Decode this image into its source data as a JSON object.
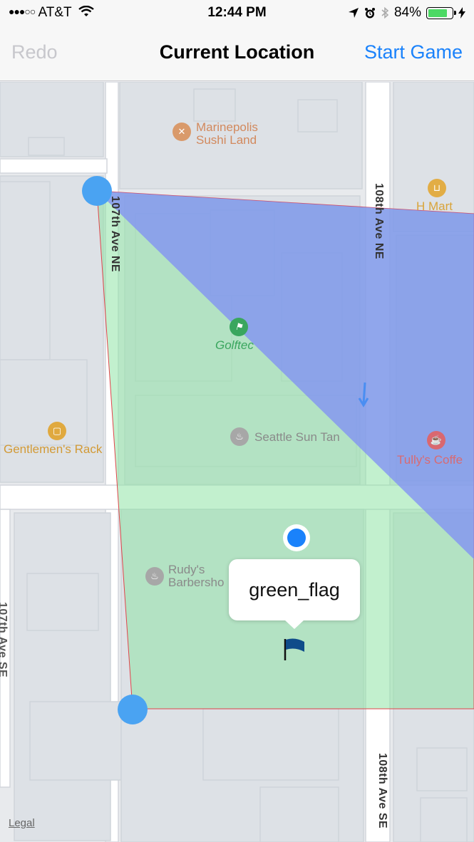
{
  "status_bar": {
    "carrier": "AT&T",
    "time": "12:44 PM",
    "battery": "84%",
    "battery_level": 0.84,
    "icons": [
      "signal-dots-icon",
      "wifi-icon",
      "location-arrow-icon",
      "alarm-clock-icon",
      "bluetooth-icon",
      "battery-icon",
      "charging-bolt-icon"
    ]
  },
  "nav_bar": {
    "left_button": "Redo",
    "title": "Current Location",
    "right_button": "Start Game"
  },
  "map": {
    "pois": [
      {
        "name_line1": "Marinepolis",
        "name_line2": "Sushi Land",
        "icon": "restaurant-icon"
      },
      {
        "name": "H Mart",
        "icon": "shopping-cart-icon"
      },
      {
        "name": "Golftec",
        "icon": "golf-icon"
      },
      {
        "name": "Gentlemen's Rack",
        "icon": "shopping-bag-icon"
      },
      {
        "name": "Seattle Sun Tan",
        "icon": "salon-icon"
      },
      {
        "name": "Tully's Coffe",
        "icon": "coffee-cup-icon"
      },
      {
        "name_line1": "Rudy's",
        "name_line2": "Barbersho",
        "icon": "salon-icon"
      }
    ],
    "streets": [
      "107th Ave NE",
      "108th Ave NE",
      "107th Ave SE",
      "108th Ave SE"
    ],
    "callout_label": "green_flag",
    "legal": "Legal",
    "colors": {
      "blue_zone": "#7f8ef6",
      "green_zone": "#8fe4a6",
      "pin_blue": "#4aa3f2",
      "user_location": "#1a82fb",
      "flag": "#0f4c8a",
      "boundary": "#e0454b"
    }
  }
}
